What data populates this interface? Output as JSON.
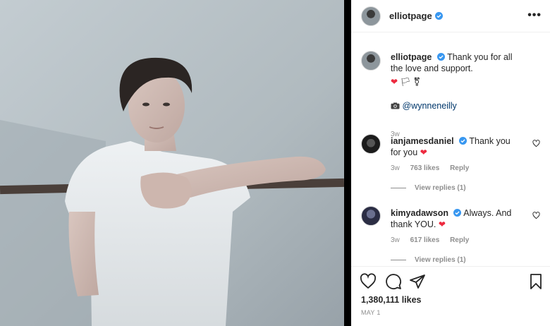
{
  "post": {
    "author": "elliotpage",
    "caption": "Thank you for all the love and support.",
    "caption_emoji": "❤️🏳️⚧",
    "credit_icon": "camera-icon",
    "credit_mention": "@wynneneilly",
    "caption_age": "3w",
    "likes": "1,380,111 likes",
    "date": "MAY 1"
  },
  "header": {
    "username": "elliotpage",
    "more_label": "•••"
  },
  "comments": [
    {
      "username": "ianjamesdaniel",
      "text": "Thank you for you",
      "emoji": "❤️",
      "age": "3w",
      "likes": "763 likes",
      "reply_label": "Reply",
      "view_replies": "View replies (1)"
    },
    {
      "username": "kimyadawson",
      "text": "Always. And thank YOU.",
      "emoji": "❤️",
      "age": "3w",
      "likes": "617 likes",
      "reply_label": "Reply",
      "view_replies": "View replies (1)"
    }
  ],
  "icons": {
    "like": "heart-icon",
    "comment": "comment-icon",
    "share": "share-icon",
    "save": "bookmark-icon",
    "verified": "verified-badge-icon"
  },
  "colors": {
    "verified_blue": "#3897f0",
    "heart_red": "#ed2a3f",
    "muted": "#8e8e8e",
    "mention": "#00376b"
  }
}
